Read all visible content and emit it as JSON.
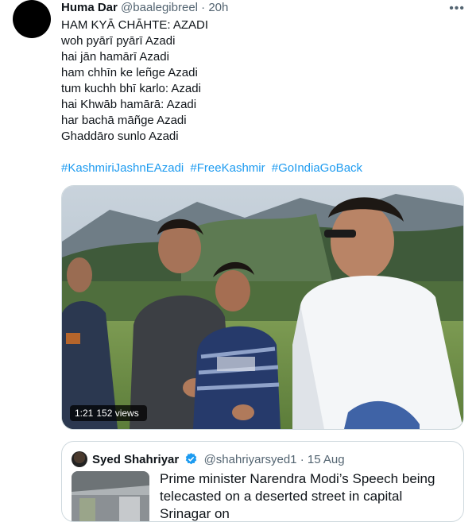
{
  "tweet": {
    "author_name": "Huma Dar",
    "author_handle": "@baalegibreel",
    "separator": "·",
    "time": "20h",
    "more_icon": "more-horizontal-icon",
    "lines": [
      "HAM KYĀ CHĀHTE: AZADI",
      "woh pyārī pyārī Azadi",
      "hai jān hamārī Azadi",
      "ham chhīn ke leñge Azadi",
      "tum kuchh bhī karlo: Azadi",
      "hai Khwāb hamārā: Azadi",
      "har bachā māñge Azadi",
      "Ghaddāro sunlo Azadi"
    ],
    "hashtags": [
      "#KashmiriJashnEAzadi",
      "#FreeKashmir",
      "#GoIndiaGoBack"
    ],
    "video": {
      "duration": "1:21",
      "views": "152 views"
    }
  },
  "quote": {
    "author_name": "Syed Shahriyar",
    "author_handle": "@shahriyarsyed1",
    "separator": "·",
    "date": "15 Aug",
    "verified_icon": "verified-badge-icon",
    "text_lines": [
      "Prime minister Narendra Modi’s Speech being",
      "telecasted on a deserted street in capital Srinagar on"
    ]
  },
  "colors": {
    "link": "#1d9bf0",
    "muted": "#536471",
    "text": "#0f1419",
    "border": "#cfd9de"
  }
}
